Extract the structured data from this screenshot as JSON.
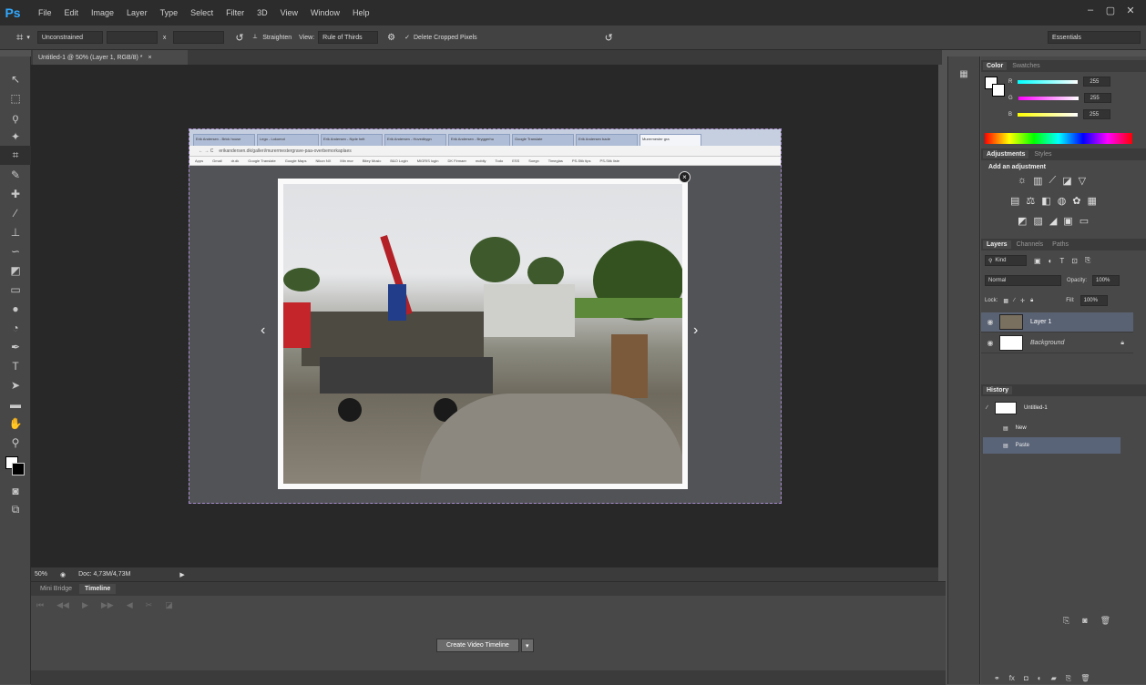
{
  "app": {
    "logo": "Ps"
  },
  "menu": [
    "File",
    "Edit",
    "Image",
    "Layer",
    "Type",
    "Select",
    "Filter",
    "3D",
    "View",
    "Window",
    "Help"
  ],
  "options": {
    "ratio": "Unconstrained",
    "straighten": "Straighten",
    "view_label": "View:",
    "view_value": "Rule of Thirds",
    "delete_cropped": "Delete Cropped Pixels",
    "workspace": "Essentials"
  },
  "document": {
    "tab_title": "Untitled-1 @ 50% (Layer 1, RGB/8) *"
  },
  "browser": {
    "tabs": [
      "Erik Andersen - Brick house",
      "Lego - Lokomot",
      "Erik Andersen - Nyde helt",
      "Erik Andersen - Hovedbygn",
      "Erik Andersen - Bryggerhu",
      "Google Translate",
      "Erik Andersen bade",
      "Murermester gra"
    ],
    "url": "erikandersen.dk/galleri/murermestergrave-paa-overbemorkaplaes",
    "bookmarks": [
      "Apps",
      "Gmail",
      "dr.dk",
      "Google Translate",
      "Google Maps",
      "Nikon NX",
      "Min mor",
      "Bitey Music",
      "B&O Login",
      "MIGRIS login",
      "DK Firmaer",
      "mobily",
      "Todo",
      "ESS",
      "Soegn",
      "Timeglas",
      "PS-Stik tips",
      "PS-Stik liste"
    ]
  },
  "status": {
    "zoom": "50%",
    "doc": "Doc: 4,73M/4,73M"
  },
  "bottom_tabs": [
    "Mini Bridge",
    "Timeline"
  ],
  "timeline": {
    "create_button": "Create Video Timeline"
  },
  "color_panel": {
    "tabs": [
      "Color",
      "Swatches"
    ],
    "r_label": "R",
    "g_label": "G",
    "b_label": "B",
    "r": "255",
    "g": "255",
    "b": "255"
  },
  "adjustments": {
    "tabs": [
      "Adjustments",
      "Styles"
    ],
    "heading": "Add an adjustment"
  },
  "layers_panel": {
    "tabs": [
      "Layers",
      "Channels",
      "Paths"
    ],
    "filter": "Kind",
    "blend_mode": "Normal",
    "opacity_label": "Opacity:",
    "opacity": "100%",
    "lock_label": "Lock:",
    "fill_label": "Fill:",
    "fill": "100%",
    "layers": [
      {
        "name": "Layer 1",
        "selected": true
      },
      {
        "name": "Background",
        "selected": false
      }
    ]
  },
  "history_panel": {
    "tab": "History",
    "snapshot": "Untitled-1",
    "items": [
      {
        "name": "New",
        "selected": false
      },
      {
        "name": "Paste",
        "selected": true
      }
    ]
  },
  "colors": {
    "accent_selection": "#596273",
    "ps_blue": "#31a8ff"
  }
}
